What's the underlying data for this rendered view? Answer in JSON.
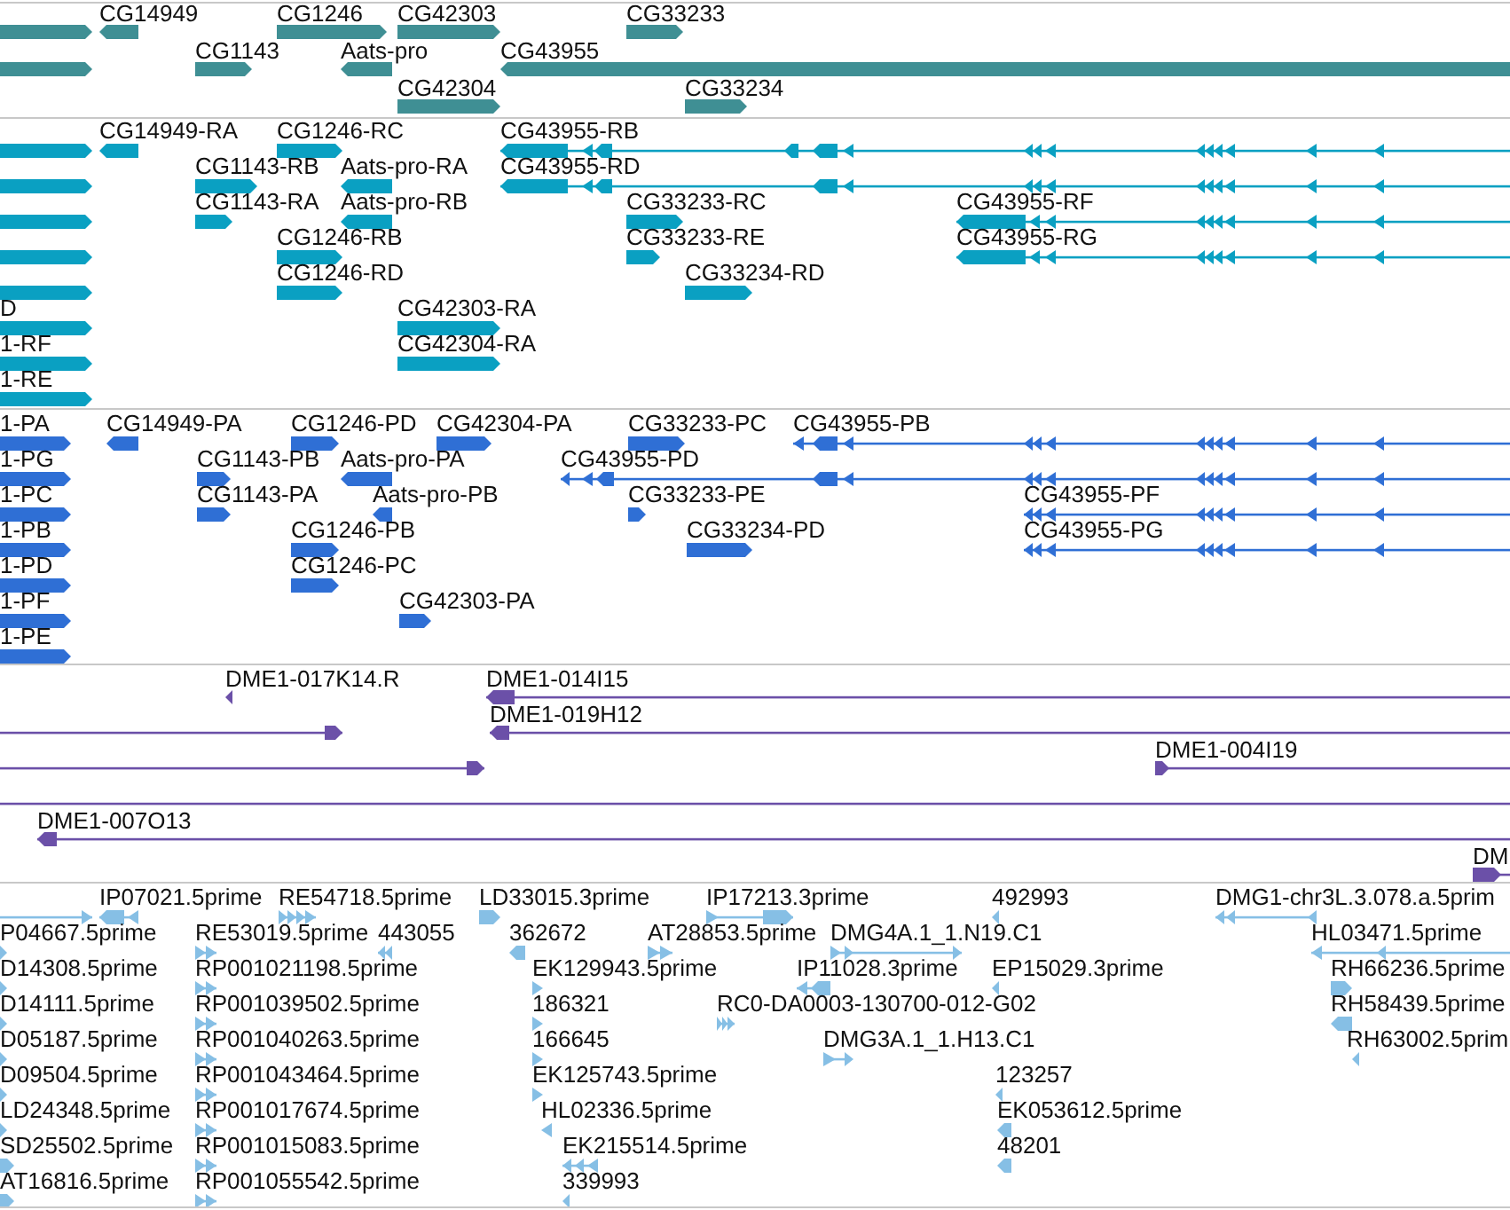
{
  "tracks": [
    {
      "kind": "gene",
      "features": [
        {
          "reverse": false
        },
        {
          "label": "CG14949",
          "reverse": true
        },
        {
          "label": "CG1246",
          "reverse": false
        },
        {
          "label": "CG42303",
          "reverse": false
        },
        {
          "label": "CG33233",
          "reverse": false
        },
        {
          "reverse": false
        },
        {
          "label": "CG1143",
          "reverse": false
        },
        {
          "label": "Aats-pro",
          "reverse": true
        },
        {
          "label": "CG43955",
          "reverse": true
        },
        {
          "label": "CG42304",
          "reverse": false
        },
        {
          "label": "CG33234",
          "reverse": false
        }
      ]
    },
    {
      "kind": "transcript",
      "features": [
        {
          "reverse": false
        },
        {
          "label": "CG14949-RA",
          "reverse": true
        },
        {
          "label": "CG1246-RC",
          "reverse": false
        },
        {
          "label": "CG43955-RB",
          "reverse": true
        },
        {
          "reverse": false
        },
        {
          "label": "CG1143-RB",
          "reverse": false
        },
        {
          "label": "Aats-pro-RA",
          "reverse": true
        },
        {
          "label": "CG43955-RD",
          "reverse": true
        },
        {
          "reverse": false
        },
        {
          "label": "CG1143-RA",
          "reverse": false
        },
        {
          "label": "Aats-pro-RB",
          "reverse": true
        },
        {
          "label": "CG33233-RC",
          "reverse": false
        },
        {
          "label": "CG43955-RF",
          "reverse": true
        },
        {
          "reverse": false
        },
        {
          "label": "CG1246-RB",
          "reverse": false
        },
        {
          "label": "CG33233-RE",
          "reverse": false
        },
        {
          "label": "CG43955-RG",
          "reverse": true
        },
        {
          "reverse": false
        },
        {
          "label": "CG1246-RD",
          "reverse": false
        },
        {
          "label": "CG33234-RD",
          "reverse": false
        },
        {
          "label": "D",
          "reverse": false
        },
        {
          "label": "CG42303-RA",
          "reverse": false
        },
        {
          "label": "1-RF",
          "reverse": false
        },
        {
          "label": "CG42304-RA",
          "reverse": false
        },
        {
          "label": "1-RE",
          "reverse": false
        }
      ]
    },
    {
      "kind": "protein",
      "features": [
        {
          "label": "1-PA",
          "reverse": false
        },
        {
          "label": "CG14949-PA",
          "reverse": true
        },
        {
          "label": "CG1246-PD",
          "reverse": false
        },
        {
          "label": "CG42304-PA",
          "reverse": false
        },
        {
          "label": "CG33233-PC",
          "reverse": false
        },
        {
          "label": "CG43955-PB",
          "reverse": true
        },
        {
          "label": "1-PG",
          "reverse": false
        },
        {
          "label": "CG1143-PB",
          "reverse": false
        },
        {
          "label": "Aats-pro-PA",
          "reverse": true
        },
        {
          "label": "CG43955-PD",
          "reverse": true
        },
        {
          "label": "1-PC",
          "reverse": false
        },
        {
          "label": "CG1143-PA",
          "reverse": false
        },
        {
          "label": "Aats-pro-PB",
          "reverse": true
        },
        {
          "label": "CG33233-PE",
          "reverse": false
        },
        {
          "label": "CG43955-PF",
          "reverse": true
        },
        {
          "label": "1-PB",
          "reverse": false
        },
        {
          "label": "CG1246-PB",
          "reverse": false
        },
        {
          "label": "CG33234-PD",
          "reverse": false
        },
        {
          "label": "CG43955-PG",
          "reverse": true
        },
        {
          "label": "1-PD",
          "reverse": false
        },
        {
          "label": "CG1246-PC",
          "reverse": false
        },
        {
          "label": "1-PF",
          "reverse": false
        },
        {
          "label": "CG42303-PA",
          "reverse": false
        },
        {
          "label": "1-PE",
          "reverse": false
        }
      ]
    },
    {
      "kind": "clone",
      "features": [
        {
          "label": "DME1-017K14.R",
          "reverse": true
        },
        {
          "label": "DME1-014I15",
          "reverse": true
        },
        {
          "reverse": false
        },
        {
          "label": "DME1-019H12",
          "reverse": true
        },
        {
          "reverse": false
        },
        {
          "label": "DME1-004I19",
          "reverse": false
        },
        {
          "reverse": false
        },
        {
          "label": "DME1-007O13",
          "reverse": true
        },
        {
          "label": "DM",
          "reverse": false
        }
      ]
    },
    {
      "kind": "est",
      "features": [
        {
          "reverse": false
        },
        {
          "label": "IP07021.5prime",
          "reverse": true
        },
        {
          "label": "RE54718.5prime",
          "reverse": false
        },
        {
          "label": "LD33015.3prime",
          "reverse": false
        },
        {
          "label": "IP17213.3prime",
          "reverse": false
        },
        {
          "label": "492993",
          "reverse": true
        },
        {
          "label": "DMG1-chr3L.3.078.a.5prim",
          "reverse": true
        },
        {
          "label": "P04667.5prime",
          "reverse": false
        },
        {
          "label": "RE53019.5prime",
          "reverse": false
        },
        {
          "label": "443055",
          "reverse": true
        },
        {
          "label": "362672",
          "reverse": true
        },
        {
          "label": "AT28853.5prime",
          "reverse": false
        },
        {
          "label": "DMG4A.1_1.N19.C1",
          "reverse": false
        },
        {
          "label": "HL03471.5prime",
          "reverse": true
        },
        {
          "label": "D14308.5prime",
          "reverse": false
        },
        {
          "label": "RP001021198.5prime",
          "reverse": false
        },
        {
          "label": "EK129943.5prime",
          "reverse": false
        },
        {
          "label": "IP11028.3prime",
          "reverse": true
        },
        {
          "label": "EP15029.3prime",
          "reverse": true
        },
        {
          "label": "RH66236.5prime",
          "reverse": false
        },
        {
          "label": "D14111.5prime",
          "reverse": false
        },
        {
          "label": "RP001039502.5prime",
          "reverse": false
        },
        {
          "label": "186321",
          "reverse": false
        },
        {
          "label": "RC0-DA0003-130700-012-G02",
          "reverse": false
        },
        {
          "label": "RH58439.5prime",
          "reverse": true
        },
        {
          "label": "D05187.5prime",
          "reverse": false
        },
        {
          "label": "RP001040263.5prime",
          "reverse": false
        },
        {
          "label": "166645",
          "reverse": false
        },
        {
          "label": "DMG3A.1_1.H13.C1",
          "reverse": false
        },
        {
          "label": "RH63002.5prim",
          "reverse": true
        },
        {
          "label": "D09504.5prime",
          "reverse": false
        },
        {
          "label": "RP001043464.5prime",
          "reverse": false
        },
        {
          "label": "EK125743.5prime",
          "reverse": false
        },
        {
          "label": "123257",
          "reverse": true
        },
        {
          "label": "LD24348.5prime",
          "reverse": false
        },
        {
          "label": "RP001017674.5prime",
          "reverse": false
        },
        {
          "label": "HL02336.5prime",
          "reverse": true
        },
        {
          "label": "EK053612.5prime",
          "reverse": true
        },
        {
          "label": "SD25502.5prime",
          "reverse": false
        },
        {
          "label": "RP001015083.5prime",
          "reverse": false
        },
        {
          "label": "EK215514.5prime",
          "reverse": true
        },
        {
          "label": "48201",
          "reverse": true
        },
        {
          "label": "AT16816.5prime",
          "reverse": false
        },
        {
          "label": "RP001055542.5prime",
          "reverse": false
        },
        {
          "label": "339993",
          "reverse": true
        }
      ]
    }
  ]
}
